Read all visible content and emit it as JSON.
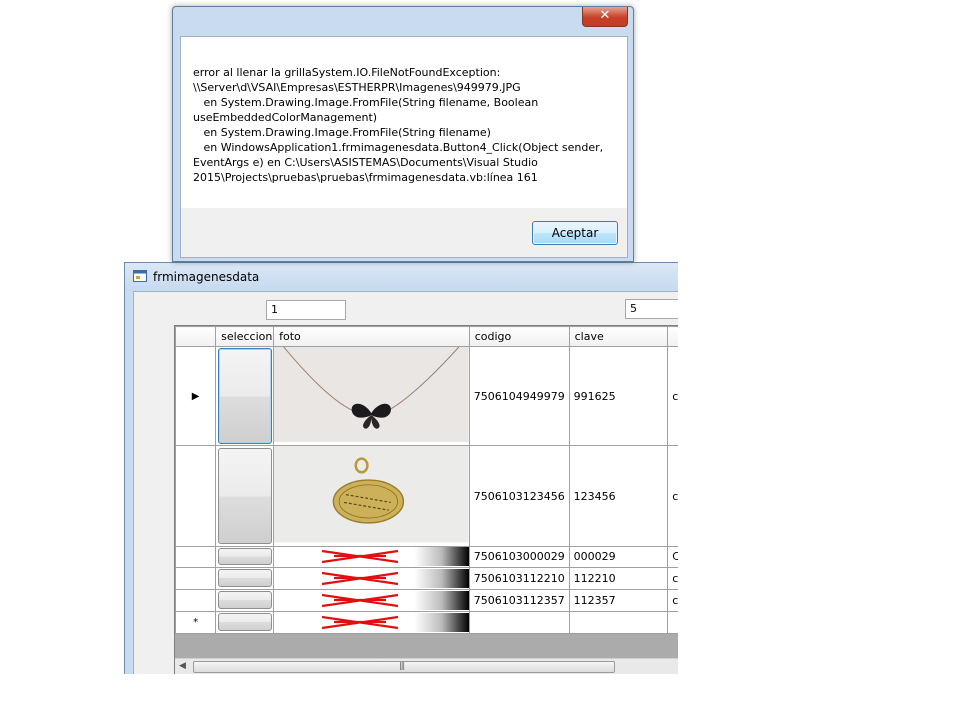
{
  "form": {
    "title": "frmimagenesdata",
    "textbox_left": "1",
    "textbox_right": "5"
  },
  "grid": {
    "columns": [
      "seleccion",
      "foto",
      "codigo",
      "clave"
    ],
    "rows": [
      {
        "codigo": "7506104949979",
        "clave": "991625",
        "extra": "c",
        "current": true
      },
      {
        "codigo": "7506103123456",
        "clave": "123456",
        "extra": "c"
      },
      {
        "codigo": "7506103000029",
        "clave": "000029",
        "extra": "C"
      },
      {
        "codigo": "7506103112210",
        "clave": "112210",
        "extra": "c"
      },
      {
        "codigo": "7506103112357",
        "clave": "112357",
        "extra": "c"
      }
    ],
    "new_row_marker": "*",
    "current_row_marker": "▶",
    "scroll_grip": "|||"
  },
  "messagebox": {
    "close_label": "✕",
    "text": "error al llenar la grillaSystem.IO.FileNotFoundException:\n\\\\Server\\d\\VSAI\\Empresas\\ESTHERPR\\Imagenes\\949979.JPG\n   en System.Drawing.Image.FromFile(String filename, Boolean\nuseEmbeddedColorManagement)\n   en System.Drawing.Image.FromFile(String filename)\n   en WindowsApplication1.frmimagenesdata.Button4_Click(Object sender,\nEventArgs e) en C:\\Users\\ASISTEMAS\\Documents\\Visual Studio\n2015\\Projects\\pruebas\\pruebas\\frmimagenesdata.vb:línea 161",
    "ok_label": "Aceptar"
  }
}
